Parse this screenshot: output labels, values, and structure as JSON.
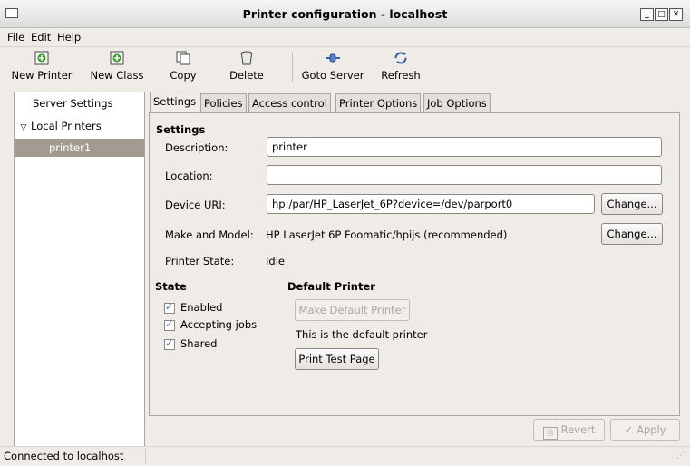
{
  "window": {
    "title": "Printer configuration - localhost"
  },
  "menu": {
    "file": "File",
    "edit": "Edit",
    "help": "Help"
  },
  "toolbar": {
    "new_printer": "New Printer",
    "new_class": "New Class",
    "copy": "Copy",
    "delete": "Delete",
    "goto_server": "Goto Server",
    "refresh": "Refresh"
  },
  "sidebar": {
    "server_settings": "Server Settings",
    "local_printers": "Local Printers",
    "printer1": "printer1"
  },
  "tabs": [
    "Settings",
    "Policies",
    "Access control",
    "Printer Options",
    "Job Options"
  ],
  "settings": {
    "heading": "Settings",
    "description_label": "Description:",
    "description_value": "printer",
    "location_label": "Location:",
    "location_value": "",
    "device_uri_label": "Device URI:",
    "device_uri_value": "hp:/par/HP_LaserJet_6P?device=/dev/parport0",
    "change_label": "Change...",
    "make_model_label": "Make and Model:",
    "make_model_value": "HP LaserJet 6P Foomatic/hpijs (recommended)",
    "printer_state_label": "Printer State:",
    "printer_state_value": "Idle"
  },
  "state": {
    "heading": "State",
    "enabled": "Enabled",
    "accepting": "Accepting jobs",
    "shared": "Shared"
  },
  "default_printer": {
    "heading": "Default Printer",
    "make_default": "Make Default Printer",
    "is_default_text": "This is the default printer",
    "print_test": "Print Test Page"
  },
  "actions": {
    "revert": "Revert",
    "apply": "Apply"
  },
  "status": {
    "text": "Connected to localhost"
  }
}
